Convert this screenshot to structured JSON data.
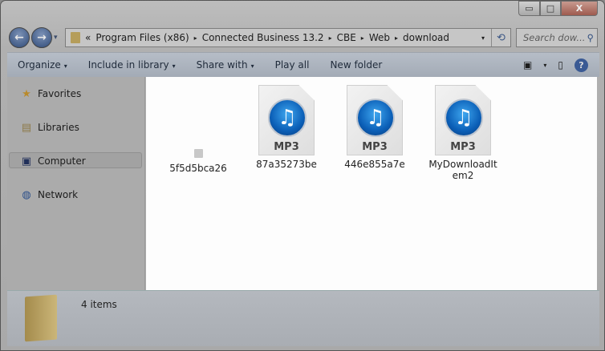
{
  "window": {
    "minimize": "▭",
    "maximize": "□",
    "close": "X"
  },
  "nav": {
    "back": "←",
    "forward": "→",
    "history": "▾"
  },
  "address": {
    "overflow": "«",
    "crumbs": [
      "Program Files (x86)",
      "Connected Business 13.2",
      "CBE",
      "Web",
      "download"
    ],
    "sep": "▸",
    "dropdown": "▾",
    "refresh": "⟲"
  },
  "search": {
    "placeholder": "Search dow...",
    "icon": "⚲"
  },
  "toolbar": {
    "organize": "Organize",
    "include": "Include in library",
    "share": "Share with",
    "play": "Play all",
    "new_folder": "New folder",
    "arrow": "▾",
    "view": "▣",
    "pane": "▯",
    "help": "?"
  },
  "sidebar": {
    "items": [
      {
        "label": "Favorites",
        "icon": "★"
      },
      {
        "label": "Libraries",
        "icon": "▤"
      },
      {
        "label": "Computer",
        "icon": "▣"
      },
      {
        "label": "Network",
        "icon": "◍"
      }
    ]
  },
  "files": [
    {
      "name": "5f5d5bca26"
    },
    {
      "name": "87a35273be",
      "type": "MP3"
    },
    {
      "name": "446e855a7e",
      "type": "MP3"
    },
    {
      "name": "MyDownloadItem2",
      "type": "MP3"
    }
  ],
  "music_glyph": "♫",
  "status": {
    "count": "4 items"
  }
}
